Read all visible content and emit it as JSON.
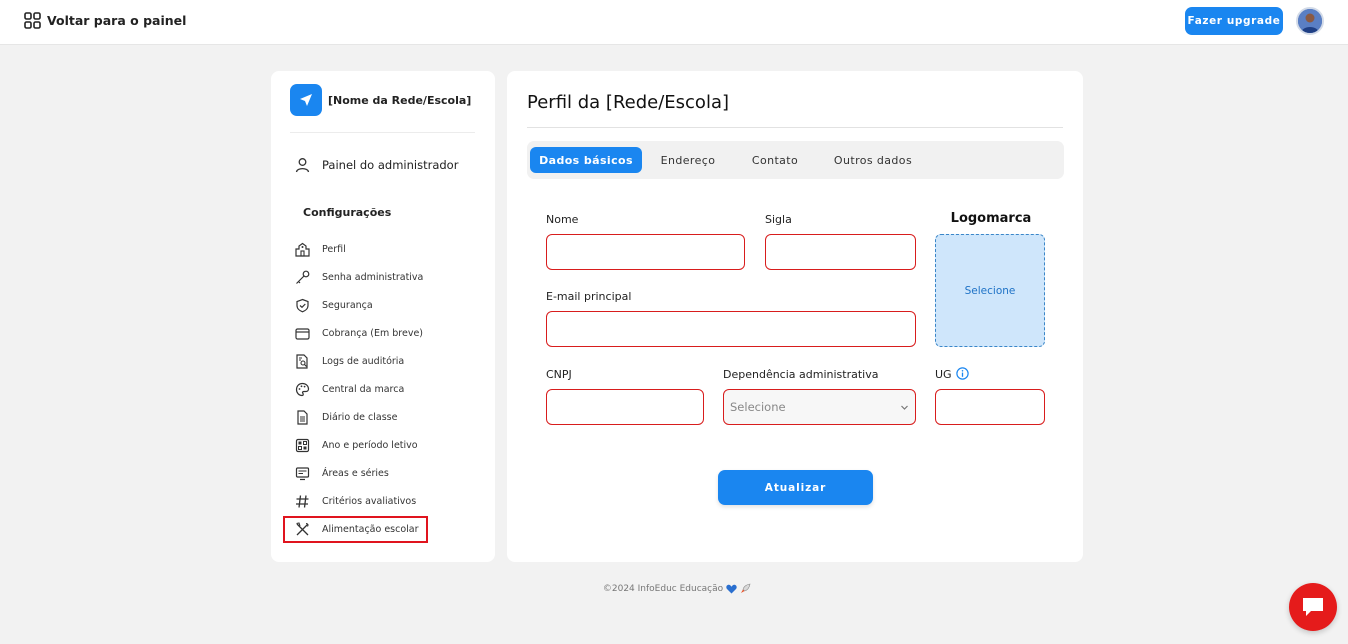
{
  "topbar": {
    "back_label": "Voltar para o painel",
    "upgrade_label": "Fazer upgrade",
    "avatar_icon": "user-avatar"
  },
  "sidebar": {
    "brand_name": "[Nome da Rede/Escola]",
    "admin_label": "Painel do administrador",
    "section_title": "Configurações",
    "items": [
      {
        "label": "Perfil",
        "icon": "school-building-icon"
      },
      {
        "label": "Senha administrativa",
        "icon": "key-icon"
      },
      {
        "label": "Segurança",
        "icon": "shield-icon"
      },
      {
        "label": "Cobrança (Em breve)",
        "icon": "wallet-icon"
      },
      {
        "label": "Logs de auditória",
        "icon": "document-search-icon"
      },
      {
        "label": "Central da marca",
        "icon": "palette-icon"
      },
      {
        "label": "Diário de classe",
        "icon": "document-icon"
      },
      {
        "label": "Ano e período letivo",
        "icon": "calendar-icon"
      },
      {
        "label": "Áreas e séries",
        "icon": "layers-icon"
      },
      {
        "label": "Critérios avaliativos",
        "icon": "hash-icon"
      },
      {
        "label": "Alimentação escolar",
        "icon": "utensils-icon"
      }
    ]
  },
  "main": {
    "title": "Perfil da [Rede/Escola]",
    "tabs": [
      {
        "label": "Dados básicos",
        "active": true
      },
      {
        "label": "Endereço",
        "active": false
      },
      {
        "label": "Contato",
        "active": false
      },
      {
        "label": "Outros dados",
        "active": false
      }
    ],
    "form": {
      "nome_label": "Nome",
      "sigla_label": "Sigla",
      "email_label": "E-mail principal",
      "cnpj_label": "CNPJ",
      "dependencia_label": "Dependência administrativa",
      "dependencia_value": "Selecione",
      "ug_label": "UG",
      "logo_title": "Logomarca",
      "logo_select": "Selecione",
      "submit_label": "Atualizar"
    }
  },
  "footer": {
    "text": "©2024 InfoEduc Educação"
  },
  "colors": {
    "accent": "#1a86f0",
    "error": "#d81d1d",
    "chat": "#e51b1b"
  }
}
